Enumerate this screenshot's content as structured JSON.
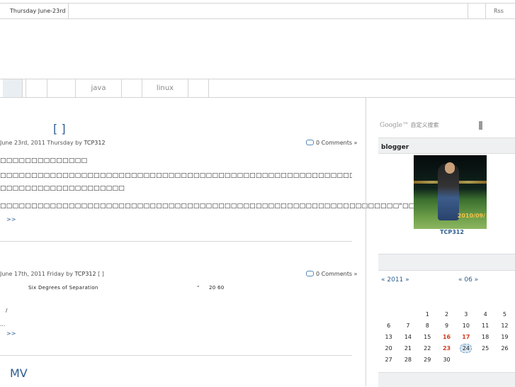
{
  "topbar": {
    "date": "Thursday June-23rd",
    "rss": "Rss"
  },
  "nav": {
    "items": [
      "",
      "",
      "",
      "",
      "java",
      "",
      "linux",
      ""
    ]
  },
  "posts": [
    {
      "title": "[ ]",
      "meta_date": "June 23rd, 2011 Thursday by ",
      "author": "TCP312",
      "comments": "0 Comments »",
      "lines": [
        "□□□□□□□□□□□□□□",
        "□□□□□□□□□□□□□□□□□□□□□□□□□□□□□□□□□□□□□□□□□□□□□□□□□□□□□□□□□□□□□□□□□□□□□□□□□□□□□□□□",
        "□□□□□□□□□□□□□□□□□□□□",
        "□□□□□□□□□□□□□□□□□□□□□□□□□□□□□□□□□□□□□□□□□□□□□□□□□□□□□□□□□□□□□□□□\"□□□..."
      ],
      "more": ">>"
    },
    {
      "meta_date": "June 17th, 2011 Friday by ",
      "author": "TCP312",
      "tag": " [ ]",
      "comments": "0 Comments »",
      "line1_a": "Six Degrees of Separation",
      "line1_b": "\"",
      "line1_c": "20 60",
      "line2": "/",
      "line3": "...",
      "more": ">>"
    },
    {
      "title": "MV"
    }
  ],
  "sidebar": {
    "search_brand": "Google™",
    "search_label": "自定义搜索",
    "blogger_head": "blogger",
    "avatar_stamp": "2010/09/",
    "blogger_name": "TCP312",
    "cal_year": "« 2011 »",
    "cal_month": "« 06 »",
    "calendar": [
      [
        "",
        "",
        "1",
        "2",
        "3",
        "4",
        "5"
      ],
      [
        "6",
        "7",
        "8",
        "9",
        "10",
        "11",
        "12"
      ],
      [
        "13",
        "14",
        "15",
        "16",
        "17",
        "18",
        "19"
      ],
      [
        "20",
        "21",
        "22",
        "23",
        "24",
        "25",
        "26"
      ],
      [
        "27",
        "28",
        "29",
        "30",
        "",
        "",
        ""
      ]
    ],
    "cal_highlight": [
      "16",
      "17",
      "23"
    ],
    "cal_today": "24"
  },
  "colors": {
    "link": "#2d5d8f",
    "highlight": "#d23b1e",
    "border": "#d4d4d4"
  }
}
